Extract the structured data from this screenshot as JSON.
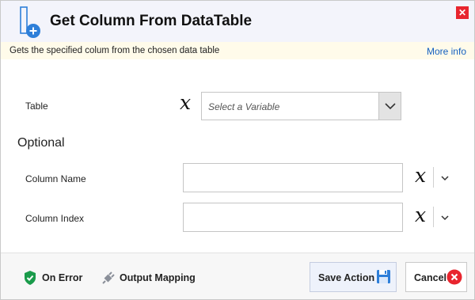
{
  "dialog": {
    "title": "Get Column From DataTable",
    "description": "Gets the specified colum from the chosen data table",
    "more_info": "More info",
    "close_glyph": "✕"
  },
  "fields": {
    "table_label": "Table",
    "table_placeholder": "Select a Variable",
    "optional_heading": "Optional",
    "column_name_label": "Column Name",
    "column_name_value": "",
    "column_index_label": "Column Index",
    "column_index_value": "",
    "variable_glyph": "x"
  },
  "footer": {
    "on_error": "On Error",
    "output_mapping": "Output Mapping",
    "save_action": "Save Action",
    "cancel": "Cancel"
  },
  "colors": {
    "header_bg": "#f3f4fb",
    "infobar_bg": "#fffbea",
    "link": "#1560c0",
    "close_red": "#e8252e",
    "shield_green": "#1a9b4b"
  }
}
